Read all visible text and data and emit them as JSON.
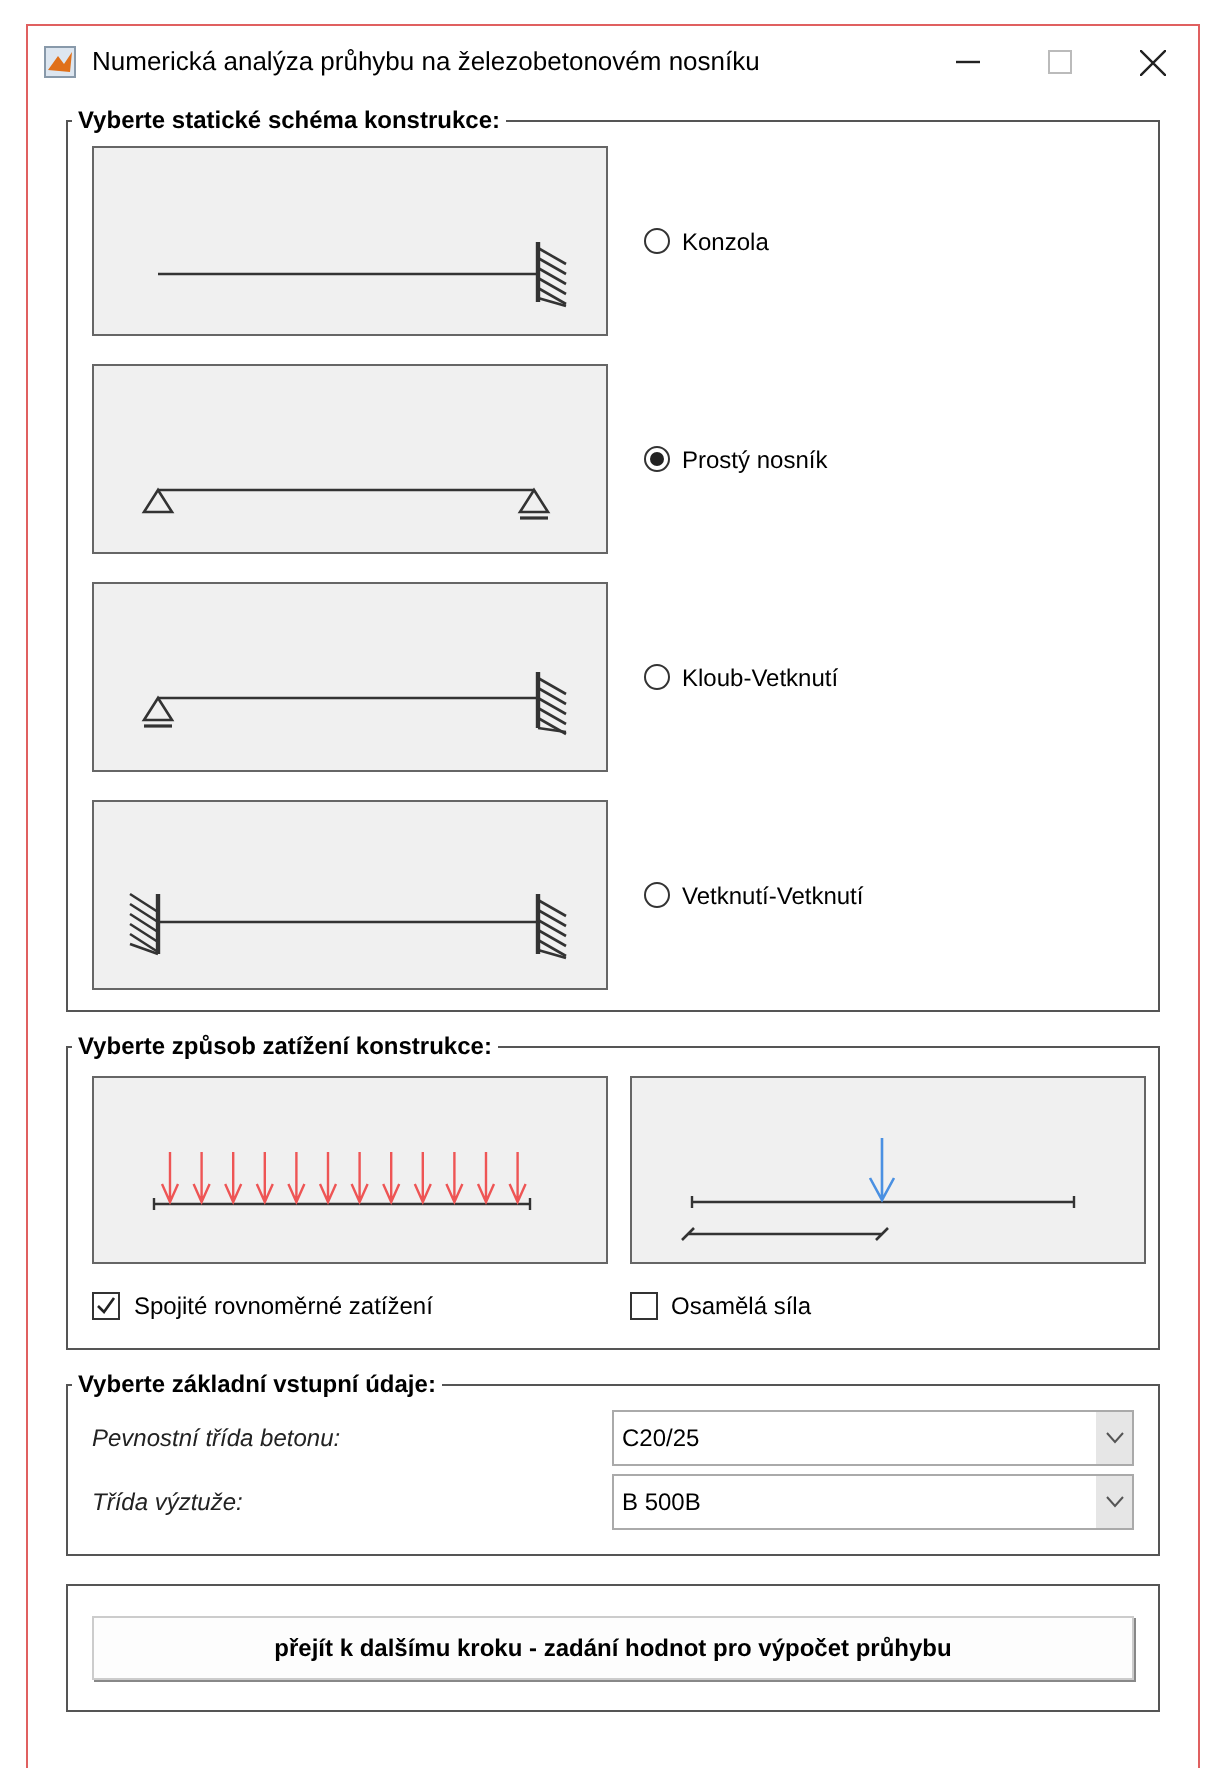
{
  "window": {
    "title": "Numerická analýza průhybu na železobetonovém nosníku"
  },
  "scheme_group": {
    "title": "Vyberte statické schéma konstrukce:",
    "schemes": [
      {
        "kind": "cantilever",
        "label": "Konzola",
        "selected": false
      },
      {
        "kind": "simple",
        "label": "Prostý nosník",
        "selected": true
      },
      {
        "kind": "pinned-fixed",
        "label": "Kloub-Vetknutí",
        "selected": false
      },
      {
        "kind": "fixed-fixed",
        "label": "Vetknutí-Vetknutí",
        "selected": false
      }
    ]
  },
  "load_group": {
    "title": "Vyberte způsob zatížení konstrukce:",
    "loads": [
      {
        "kind": "distributed",
        "label": "Spojité rovnoměrné zatížení",
        "checked": true
      },
      {
        "kind": "point",
        "label": "Osamělá síla",
        "checked": false
      }
    ]
  },
  "input_group": {
    "title": "Vyberte základní vstupní údaje:",
    "fields": [
      {
        "label": "Pevnostní třída betonu:",
        "value": "C20/25"
      },
      {
        "label": "Třída výztuže:",
        "value": "B 500B"
      }
    ]
  },
  "next_button": {
    "label": "přejít k dalšímu kroku - zadání hodnot pro výpočet průhybu"
  }
}
